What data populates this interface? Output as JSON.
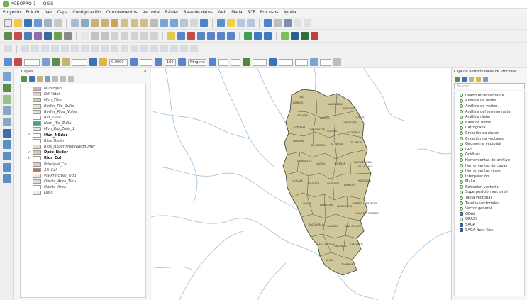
{
  "window": {
    "title": "*GEOPRO-1 — QGIS"
  },
  "menu": [
    "Proyecto",
    "Edición",
    "Ver",
    "Capa",
    "Configuración",
    "Complementos",
    "Vectorial",
    "Ráster",
    "Base de datos",
    "Web",
    "Malla",
    "SCP",
    "Procesos",
    "Ayuda"
  ],
  "toolbar": {
    "scale_value": "0.0000",
    "zoom_value": "100",
    "select_value": "Ninguno"
  },
  "layers_panel": {
    "title": "Capas",
    "items": [
      {
        "name": "Municipio",
        "checked": false,
        "color": "#e8a7a7",
        "bold": false
      },
      {
        "name": "Dif_Total",
        "checked": false,
        "color": "#f2c7c7",
        "bold": false
      },
      {
        "name": "Mun_Tibu",
        "checked": false,
        "color": "#b7ddb0",
        "bold": false
      },
      {
        "name": "Buffer_Rio_Zulia",
        "checked": false,
        "color": "#f1e2c2",
        "bold": false
      },
      {
        "name": "Buffer_Rios_Nulos",
        "checked": false,
        "color": "#f2dede",
        "bold": false
      },
      {
        "name": "Rio_Zulia",
        "checked": false,
        "color": "#ffffff",
        "bold": false
      },
      {
        "name": "Nom_Rio_Zulia",
        "checked": false,
        "color": "#3da57c",
        "bold": false
      },
      {
        "name": "Mun_Rio_Zulia_1",
        "checked": false,
        "color": "#f3e1c8",
        "bold": false
      },
      {
        "name": "Mun_NSder",
        "checked": true,
        "color": "#ffffff",
        "bold": true
      },
      {
        "name": "Rios_Nsder",
        "checked": false,
        "color": "#ffffff",
        "bold": false
      },
      {
        "name": "Rios_Nsder MultiNsegBuffer",
        "checked": false,
        "color": "#f5d9b5",
        "bold": false
      },
      {
        "name": "Dpto_Nsder",
        "checked": true,
        "color": "#d8cf9a",
        "bold": true
      },
      {
        "name": "Rios_Col",
        "checked": true,
        "color": "#ffffff",
        "bold": true
      },
      {
        "name": "Principal_Col",
        "checked": false,
        "color": "#f0c5c5",
        "bold": false
      },
      {
        "name": "Alt_Col",
        "checked": false,
        "color": "#c96d6d",
        "bold": false
      },
      {
        "name": "via Principal_Tibu",
        "checked": false,
        "color": "#f6ead2",
        "bold": false
      },
      {
        "name": "Oferta_Area_Tibu",
        "checked": false,
        "color": "#e8dada",
        "bold": false
      },
      {
        "name": "Oferta_Area",
        "checked": false,
        "color": "#ffffff",
        "bold": false
      },
      {
        "name": "Dpto",
        "checked": false,
        "color": "#f1ece1",
        "bold": false
      }
    ]
  },
  "map": {
    "polygon_fill": "#cfc79a",
    "polygon_stroke": "#4a4a3a",
    "river_color": "#9fbfd9",
    "labels": [
      "ABREGO",
      "ARBOLEDAS",
      "BUCARASICA",
      "CÁCHIRA",
      "CÁCOTA",
      "CHINÁCOTA",
      "CHITAGÁ",
      "CONVENCIÓN",
      "CÚCUTA",
      "CUCUTILLA",
      "DURANIA",
      "EL CARMEN",
      "EL TARRA",
      "EL ZULIA",
      "GRAMALOTE",
      "HACARÍ",
      "HERRÁN",
      "LA ESPERANZA",
      "LA PLAYA",
      "LABATECA",
      "LOS PATIOS",
      "LOURDES",
      "MUTISCUA",
      "OCAÑA",
      "PAMPLONA",
      "PAMPLONITA",
      "PUERTO SANTANDER",
      "RAGONVALIA",
      "SALAZAR",
      "SAN CALIXTO",
      "SAN CAYETANO",
      "SANTIAGO",
      "SARDINATA",
      "SILOS",
      "TEORAMA",
      "TIBÚ",
      "TOLEDO",
      "VILLA CARO",
      "VILLA DEL ROSARIO"
    ]
  },
  "processing": {
    "title": "Caja de herramientas de Procesos",
    "search_placeholder": "Buscar...",
    "items": [
      {
        "label": "Usado recientemente",
        "icon": "clock"
      },
      {
        "label": "Análisis de redes",
        "icon": "qgis"
      },
      {
        "label": "Análisis de vector",
        "icon": "qgis"
      },
      {
        "label": "Análisis del terreno ráster",
        "icon": "qgis"
      },
      {
        "label": "Análisis ráster",
        "icon": "qgis"
      },
      {
        "label": "Base de datos",
        "icon": "qgis"
      },
      {
        "label": "Cartografía",
        "icon": "qgis"
      },
      {
        "label": "Creación de ráster",
        "icon": "qgis"
      },
      {
        "label": "Creación de vectores",
        "icon": "qgis"
      },
      {
        "label": "Geometría vectorial",
        "icon": "qgis"
      },
      {
        "label": "GPS",
        "icon": "qgis"
      },
      {
        "label": "Gráficos",
        "icon": "qgis"
      },
      {
        "label": "Herramientas de archivo",
        "icon": "qgis"
      },
      {
        "label": "Herramientas de capas",
        "icon": "qgis"
      },
      {
        "label": "Herramientas ráster",
        "icon": "qgis"
      },
      {
        "label": "Interpolación",
        "icon": "qgis"
      },
      {
        "label": "Malla",
        "icon": "qgis"
      },
      {
        "label": "Selección vectorial",
        "icon": "qgis"
      },
      {
        "label": "Superposición vectorial",
        "icon": "qgis"
      },
      {
        "label": "Tabla vectorial",
        "icon": "qgis"
      },
      {
        "label": "Teselas vectoriales",
        "icon": "qgis"
      },
      {
        "label": "Vector general",
        "icon": "qgis"
      },
      {
        "label": "GDAL",
        "icon": "gdal"
      },
      {
        "label": "GRASS",
        "icon": "grass"
      },
      {
        "label": "SAGA",
        "icon": "saga"
      },
      {
        "label": "SAGA Next Gen",
        "icon": "saga"
      }
    ]
  }
}
